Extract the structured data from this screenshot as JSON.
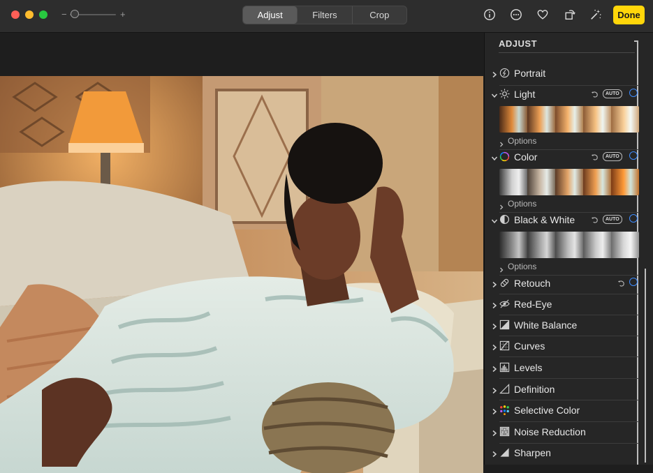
{
  "toolbar": {
    "zoom_minus": "−",
    "zoom_plus": "+",
    "tabs": [
      {
        "label": "Adjust",
        "active": true
      },
      {
        "label": "Filters",
        "active": false
      },
      {
        "label": "Crop",
        "active": false
      }
    ],
    "icons": [
      "info-icon",
      "more-icon",
      "heart-icon",
      "rotate-icon",
      "magic-wand-icon"
    ],
    "done_label": "Done"
  },
  "panel": {
    "title": "ADJUST",
    "auto_label": "AUTO",
    "options_label": "Options",
    "items": [
      {
        "label": "Portrait",
        "icon": "portrait-icon"
      },
      {
        "label": "Light",
        "icon": "sun-icon"
      },
      {
        "label": "Color",
        "icon": "color-wheel-icon"
      },
      {
        "label": "Black & White",
        "icon": "half-circle-icon"
      },
      {
        "label": "Retouch",
        "icon": "bandage-icon"
      },
      {
        "label": "Red-Eye",
        "icon": "eye-icon"
      },
      {
        "label": "White Balance",
        "icon": "white-balance-icon"
      },
      {
        "label": "Curves",
        "icon": "curves-icon"
      },
      {
        "label": "Levels",
        "icon": "levels-icon"
      },
      {
        "label": "Definition",
        "icon": "definition-icon"
      },
      {
        "label": "Selective Color",
        "icon": "selective-color-icon"
      },
      {
        "label": "Noise Reduction",
        "icon": "noise-icon"
      },
      {
        "label": "Sharpen",
        "icon": "sharpen-icon"
      }
    ]
  },
  "colors": {
    "accent_yellow": "#ffd60a",
    "toggle_blue": "#3d8bff"
  }
}
